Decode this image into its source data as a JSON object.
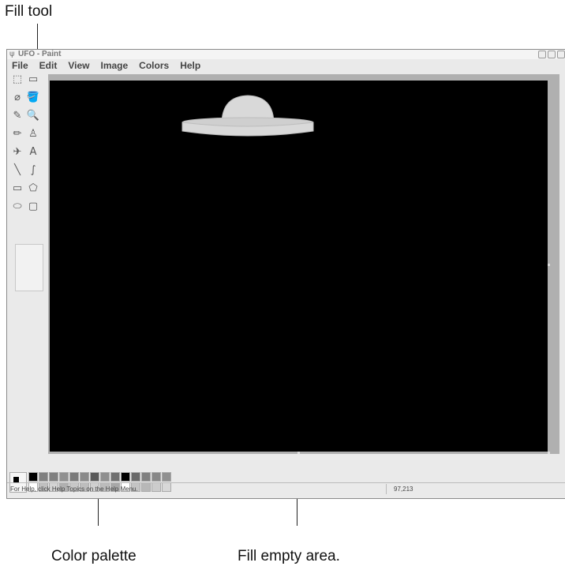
{
  "annotations": {
    "fill_tool": "Fill tool",
    "color_palette": "Color palette",
    "fill_empty_area": "Fill empty area."
  },
  "window": {
    "title": "UFO - Paint"
  },
  "menu": [
    "File",
    "Edit",
    "View",
    "Image",
    "Colors",
    "Help"
  ],
  "tools": [
    {
      "name": "free-form-select-icon",
      "glyph": "⬚"
    },
    {
      "name": "select-icon",
      "glyph": "▭"
    },
    {
      "name": "eraser-icon",
      "glyph": "⌀"
    },
    {
      "name": "fill-icon",
      "glyph": "🪣"
    },
    {
      "name": "pick-color-icon",
      "glyph": "✎"
    },
    {
      "name": "magnifier-icon",
      "glyph": "🔍"
    },
    {
      "name": "pencil-icon",
      "glyph": "✏"
    },
    {
      "name": "brush-icon",
      "glyph": "♙"
    },
    {
      "name": "airbrush-icon",
      "glyph": "✈"
    },
    {
      "name": "text-icon",
      "glyph": "A"
    },
    {
      "name": "line-icon",
      "glyph": "╲"
    },
    {
      "name": "curve-icon",
      "glyph": "∫"
    },
    {
      "name": "rectangle-icon",
      "glyph": "▭"
    },
    {
      "name": "polygon-icon",
      "glyph": "⬠"
    },
    {
      "name": "ellipse-icon",
      "glyph": "⬭"
    },
    {
      "name": "rounded-rectangle-icon",
      "glyph": "▢"
    }
  ],
  "selected_tool": "fill-icon",
  "canvas": {
    "background": "#000000",
    "ufo_color": "#d9d9d9"
  },
  "palette": {
    "foreground": "#000000",
    "background": "#ffffff",
    "colors_top": [
      "#000000",
      "#808080",
      "#808080",
      "#909090",
      "#7a7a7a",
      "#8a8a8a",
      "#5a5a5a",
      "#8f8f8f",
      "#707070",
      "#000000",
      "#6a6a6a",
      "#808080",
      "#888888",
      "#909090"
    ],
    "colors_bottom": [
      "#ffffff",
      "#c0c0c0",
      "#d4d4d4",
      "#b0b0b0",
      "#c8c8c8",
      "#bdbdbd",
      "#d0d0d0",
      "#bcbcbc",
      "#a8a8a8",
      "#ffffff",
      "#c4c4c4",
      "#b8b8b8",
      "#cccccc",
      "#d8d8d8"
    ]
  },
  "status": {
    "help": "For Help, click Help Topics on the Help Menu.",
    "coords": "97,213"
  }
}
